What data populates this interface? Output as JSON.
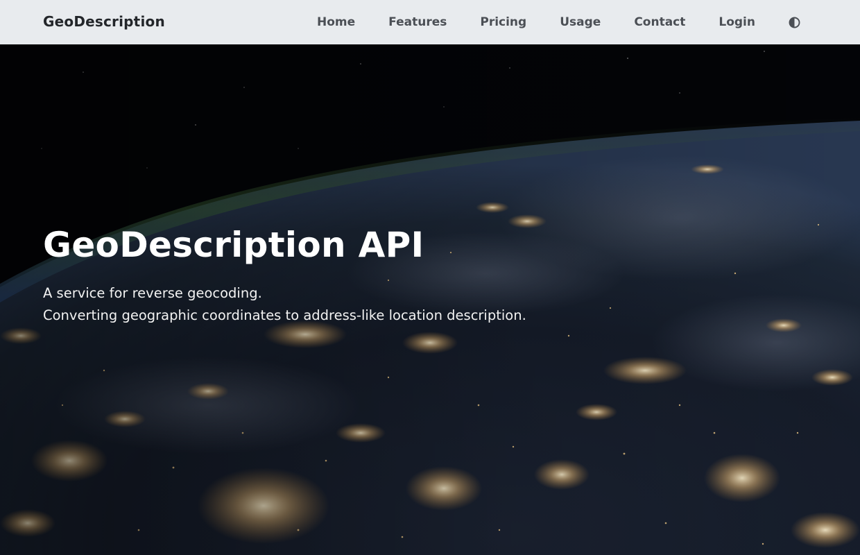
{
  "header": {
    "brand": "GeoDescription",
    "nav": [
      {
        "label": "Home"
      },
      {
        "label": "Features"
      },
      {
        "label": "Pricing"
      },
      {
        "label": "Usage"
      },
      {
        "label": "Contact"
      },
      {
        "label": "Login"
      }
    ],
    "theme_toggle_icon": "contrast-icon"
  },
  "hero": {
    "title": "GeoDescription API",
    "subtitle_line1": "A service for reverse geocoding.",
    "subtitle_line2": "Converting geographic coordinates to address-like location description.",
    "background": "earth-at-night-from-space"
  },
  "colors": {
    "navbar_bg": "#e8ebee",
    "brand_text": "#23262a",
    "nav_text": "#4b4f55",
    "hero_text": "#ffffff",
    "city_lights": "#f3c27a"
  }
}
